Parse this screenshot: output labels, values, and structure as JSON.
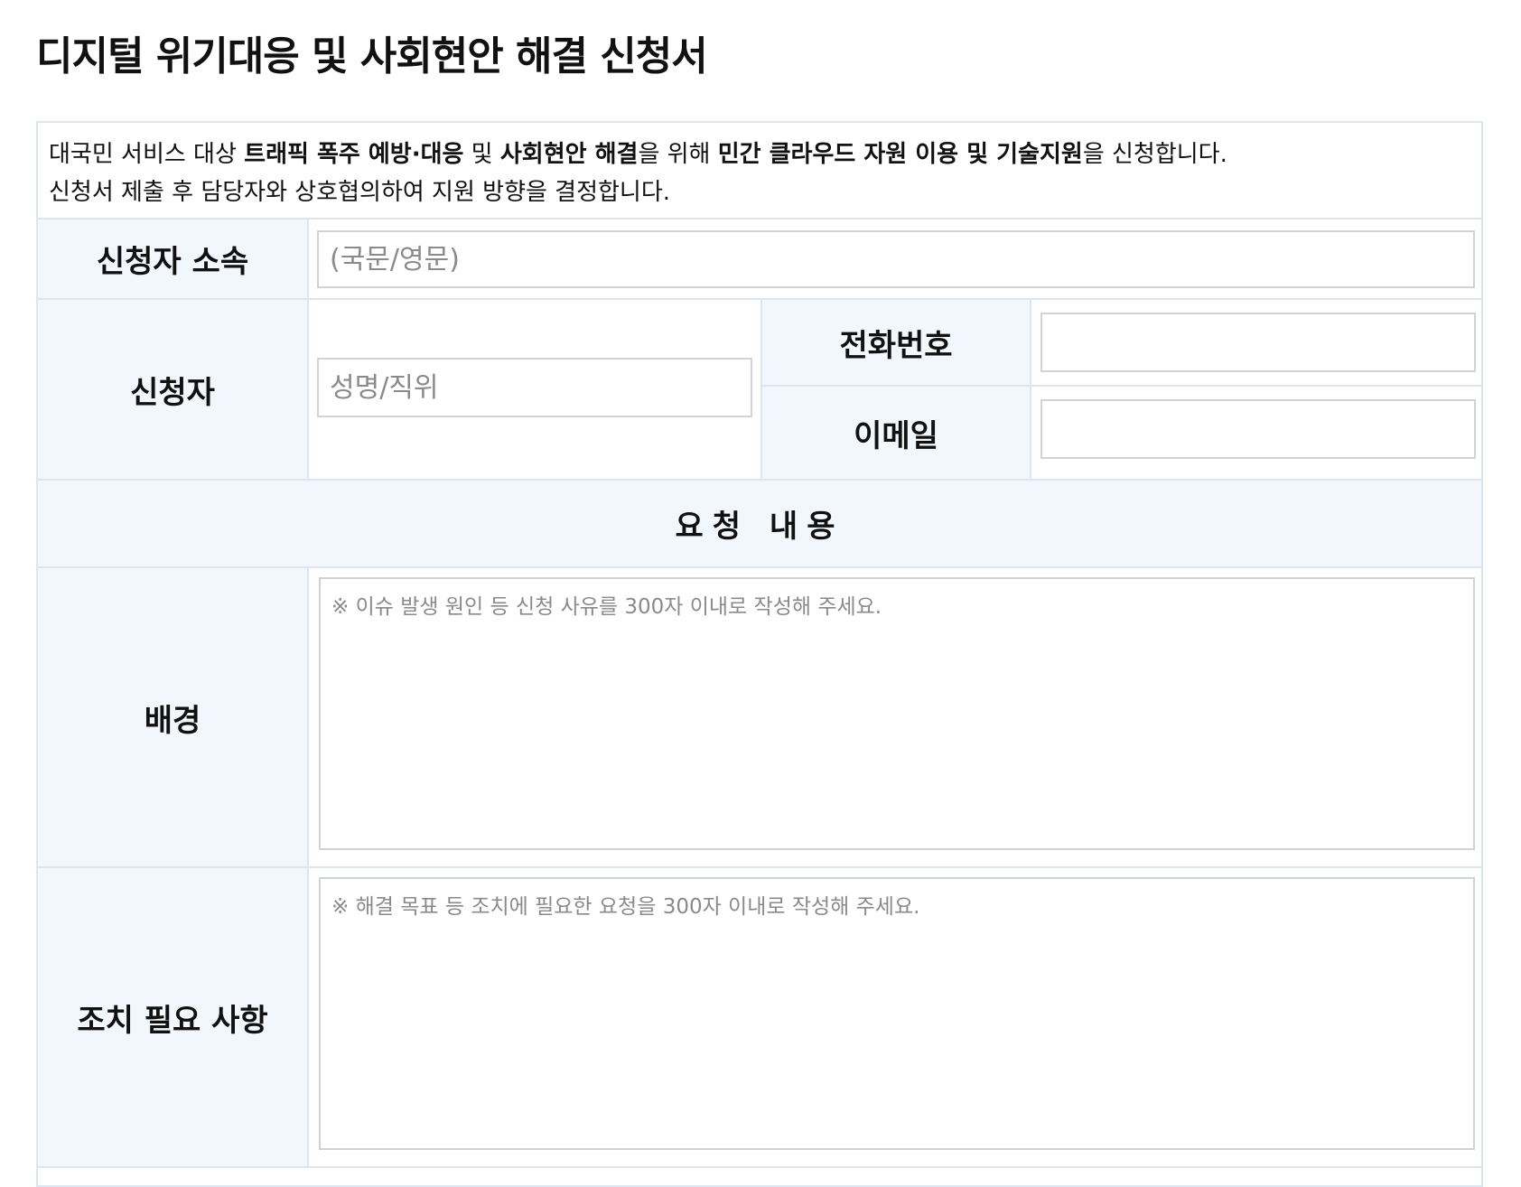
{
  "title": "디지털 위기대응 및 사회현안 해결 신청서",
  "intro": {
    "line1": [
      {
        "text": "대국민 서비스 대상 ",
        "bold": false
      },
      {
        "text": "트래픽 폭주 예방·대응",
        "bold": true
      },
      {
        "text": " 및 ",
        "bold": false
      },
      {
        "text": "사회현안 해결",
        "bold": true
      },
      {
        "text": "을 위해 ",
        "bold": false
      },
      {
        "text": "민간 클라우드 자원 이용 및 기술지원",
        "bold": true
      },
      {
        "text": "을 신청합니다.",
        "bold": false
      }
    ],
    "line2": "신청서 제출 후 담당자와 상호협의하여 지원 방향을 결정합니다."
  },
  "affiliation": {
    "label": "신청자 소속",
    "placeholder": "(국문/영문)",
    "value": ""
  },
  "applicant": {
    "label": "신청자",
    "placeholder": "성명/직위",
    "value": ""
  },
  "phone": {
    "label": "전화번호",
    "placeholder": "",
    "value": ""
  },
  "email": {
    "label": "이메일",
    "placeholder": "",
    "value": ""
  },
  "request_section": {
    "title": "요청 내용"
  },
  "background": {
    "label": "배경",
    "placeholder": "※ 이슈 발생 원인 등 신청 사유를 300자 이내로 작성해 주세요.",
    "value": ""
  },
  "actions": {
    "label": "조치 필요 사항",
    "placeholder": "※ 해결 목표 등 조치에 필요한 요청을 300자 이내로 작성해 주세요.",
    "value": ""
  },
  "colors": {
    "label_bg": "#f1f7fd",
    "border": "#dde6ee",
    "input_border": "#cfd3d6"
  }
}
